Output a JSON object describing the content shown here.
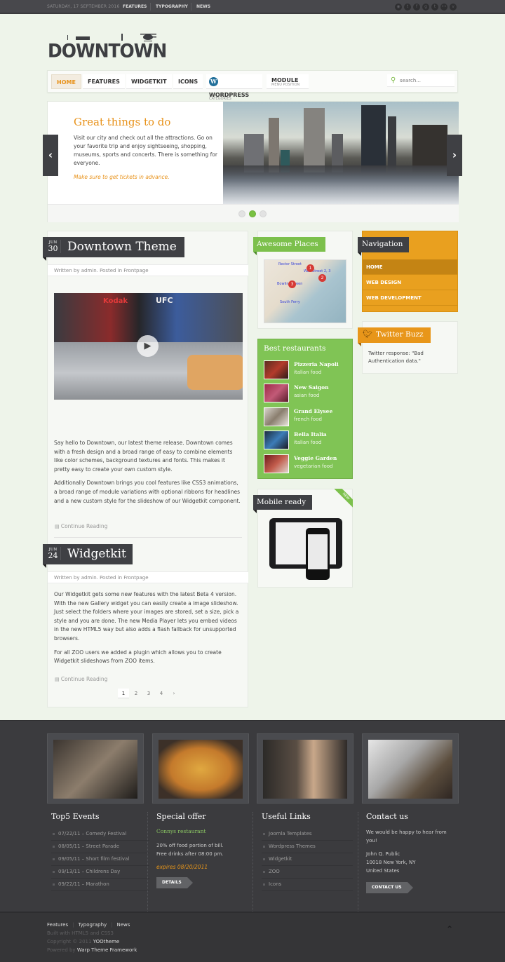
{
  "topbar": {
    "date": "SATURDAY, 17 SEPTEMBER 2016",
    "links": [
      "FEATURES",
      "TYPOGRAPHY",
      "NEWS"
    ],
    "social_icons": [
      "rss-icon",
      "twitter-icon",
      "facebook-icon",
      "google-icon",
      "tumblr-icon",
      "flickr-icon",
      "vimeo-icon"
    ]
  },
  "logo": {
    "text": "DOWNTOWN"
  },
  "nav": {
    "items": [
      {
        "label": "HOME",
        "active": true
      },
      {
        "label": "FEATURES"
      },
      {
        "label": "WIDGETKIT"
      },
      {
        "label": "ICONS"
      },
      {
        "label": "WORDPRESS",
        "sub": "CATEGORIES"
      },
      {
        "label": "MODULE",
        "sub": "MENU POSITION"
      }
    ],
    "search_placeholder": "search..."
  },
  "slideshow": {
    "title": "Great things to do",
    "text": "Visit our city and check out all the attractions. Go on your favorite trip and enjoy sightseeing, shopping, museums, sports and concerts. There is something for everyone.",
    "note": "Make sure to get tickets in advance.",
    "prev": "‹",
    "next": "›",
    "active_slide": 2,
    "slide_count": 3
  },
  "articles": [
    {
      "month": "JUN",
      "day": "30",
      "title": "Downtown Theme",
      "meta": "Written by admin. Posted in Frontpage",
      "paragraphs": [
        "Say hello to Downtown, our latest theme release. Downtown comes with a fresh design and a broad range of easy to combine elements like color schemes, background textures and fonts. This makes it pretty easy to create your own custom style.",
        "Additionally Downtown brings you cool features like CSS3 animations, a broad range of module variations with optional ribbons for headlines and a new custom style for the slideshow of our Widgetkit component."
      ],
      "continue": "Continue Reading"
    },
    {
      "month": "JUN",
      "day": "24",
      "title": "Widgetkit",
      "meta": "Written by admin. Posted in Frontpage",
      "paragraphs": [
        "Our Widgetkit gets some new features with the latest Beta 4 version. With the new Gallery widget you can easily create a image slideshow. Just select the folders where your images are stored, set a size, pick a style and you are done. The new Media Player lets you embed videos in the new HTML5 way but also adds a flash fallback for unsupported browsers.",
        "For all ZOO users we added a plugin which allows you to create Widgetkit slideshows from ZOO items."
      ],
      "continue": "Continue Reading"
    }
  ],
  "pagination": {
    "pages": [
      "1",
      "2",
      "3",
      "4"
    ],
    "current": "1",
    "next": "›"
  },
  "awesome_places": {
    "title": "Awesome Places",
    "map_labels": [
      "Rector Street",
      "Wall Street 2, 3",
      "Bowling Green",
      "South Ferry"
    ],
    "markers": [
      "1",
      "2",
      "3"
    ]
  },
  "restaurants": {
    "title": "Best restaurants",
    "items": [
      {
        "name": "Pizzeria Napoli",
        "type": "italian food"
      },
      {
        "name": "New Saigon",
        "type": "asian food"
      },
      {
        "name": "Grand Elysee",
        "type": "french food"
      },
      {
        "name": "Bella Italia",
        "type": "italian food"
      },
      {
        "name": "Veggie Garden",
        "type": "vegetarian food"
      }
    ]
  },
  "mobile": {
    "title": "Mobile ready",
    "badge": "NEW"
  },
  "navigation_widget": {
    "title": "Navigation",
    "items": [
      {
        "label": "HOME",
        "active": true
      },
      {
        "label": "WEB DESIGN"
      },
      {
        "label": "WEB DEVELOPMENT"
      }
    ]
  },
  "twitter": {
    "title": "Twitter Buzz",
    "text": "Twitter response: \"Bad Authentication data.\""
  },
  "footer": {
    "events": {
      "title": "Top5 Events",
      "items": [
        "07/22/11 – Comedy Festival",
        "08/05/11 – Street Parade",
        "09/05/11 – Short film festival",
        "09/13/11 – Childrens Day",
        "09/22/11 – Marathon"
      ]
    },
    "offer": {
      "title": "Special offer",
      "restaurant": "Connys restaurant",
      "line1": "20% off food portion of bill.",
      "line2": "Free drinks after 08:00 pm.",
      "expires": "expires 08/20/2011",
      "button": "DETAILS"
    },
    "links": {
      "title": "Useful Links",
      "items": [
        "Joomla Templates",
        "Wordpress Themes",
        "Widgetkit",
        "ZOO",
        "Icons"
      ]
    },
    "contact": {
      "title": "Contact us",
      "intro": "We would be happy to hear from you!",
      "name": "John Q. Public",
      "city": "10018 New York, NY",
      "country": "United States",
      "button": "CONTACT US"
    }
  },
  "bottom": {
    "links": [
      "Features",
      "Typography",
      "News"
    ],
    "built": "Built with HTML5 and CSS3",
    "copyright_prefix": "Copyright © 2011",
    "copyright_brand": "YOOtheme",
    "powered_prefix": "Powered by",
    "powered_brand": "Warp Theme Framework",
    "totop": "⌃"
  }
}
